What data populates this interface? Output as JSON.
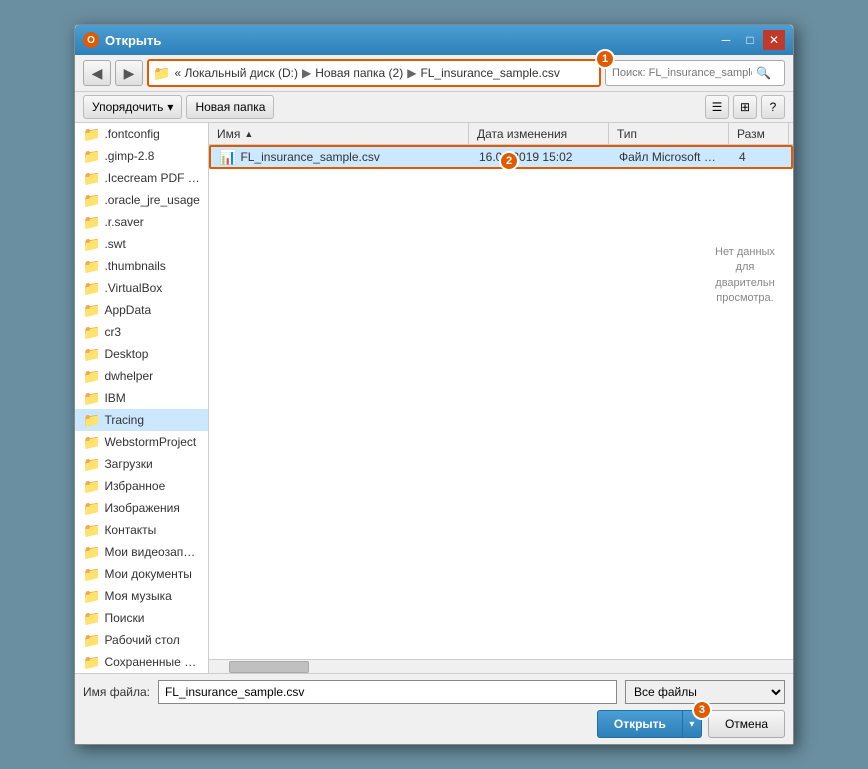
{
  "dialog": {
    "title": "Открыть",
    "title_icon": "O"
  },
  "address_bar": {
    "path": "« Локальный диск (D:) ▶ Новая папка (2) ▶ FL_insurance_sample.csv",
    "part1": "« Локальный диск (D:)",
    "sep1": "▶",
    "part2": "Новая папка (2)",
    "sep2": "▶",
    "part3": "FL_insurance_sample.csv"
  },
  "search": {
    "placeholder": "Поиск: FL_insurance_sample.csv",
    "value": ""
  },
  "toolbar": {
    "sort_label": "Упорядочить",
    "new_folder_label": "Новая папка"
  },
  "columns": {
    "name": "Имя",
    "date": "Дата изменения",
    "type": "Тип",
    "size": "Разм"
  },
  "folders": [
    ".fontconfig",
    ".gimp-2.8",
    ".Icecream PDF Co",
    ".oracle_jre_usage",
    ".r.saver",
    ".swt",
    ".thumbnails",
    ".VirtualBox",
    "AppData",
    "cr3",
    "Desktop",
    "dwhelper",
    "IBM",
    "Tracing",
    "WebstormProject",
    "Загрузки",
    "Избранное",
    "Изображения",
    "Контакты",
    "Мои видеозаписи",
    "Мои документы",
    "Моя музыка",
    "Поиски",
    "Рабочий стол",
    "Сохраненные игр"
  ],
  "files": [
    {
      "name": "FL_insurance_sample.csv",
      "date": "16.02.2019 15:02",
      "type": "Файл Microsoft Ex...",
      "size": "4"
    }
  ],
  "preview": {
    "text": "Нет данных для дварительн просмотра."
  },
  "bottom": {
    "filename_label": "Имя файла:",
    "filename_value": "FL_insurance_sample.csv",
    "filetype_value": "Все файлы",
    "open_btn": "Открыть",
    "cancel_btn": "Отмена"
  },
  "badges": {
    "b1": "1",
    "b2": "2",
    "b3": "3"
  }
}
